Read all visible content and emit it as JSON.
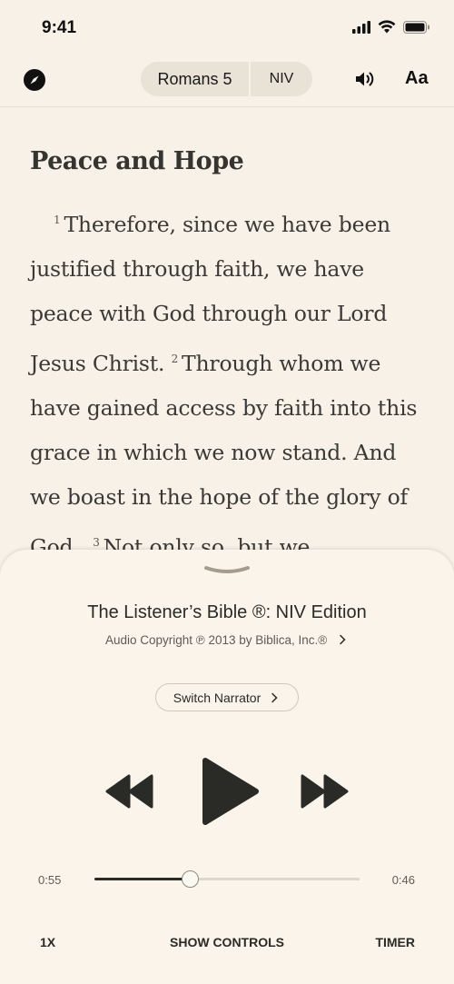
{
  "status_bar": {
    "time": "9:41"
  },
  "toolbar": {
    "book_chapter": "Romans 5",
    "version": "NIV",
    "font_button": "Aa"
  },
  "reader": {
    "section_title": "Peace and Hope",
    "verses": [
      {
        "number": "1",
        "text": "Therefore, since we have been justified through faith, we have peace with God through our Lord Jesus Christ."
      },
      {
        "number": "2",
        "text": "Through whom we have gained access by faith into this grace in which we now stand. And we boast in the hope of the glory of God."
      },
      {
        "number": "3",
        "text": "Not only so, but we"
      }
    ]
  },
  "player": {
    "audio_title": "The Listener’s Bible ®:  NIV Edition",
    "copyright": "Audio Copyright ℗ 2013 by Biblica, Inc.®",
    "switch_narrator": "Switch Narrator",
    "time_elapsed": "0:55",
    "time_remaining": "0:46",
    "progress_fraction": 0.36,
    "speed_label": "1X",
    "show_controls_label": "SHOW CONTROLS",
    "timer_label": "TIMER"
  },
  "icons": {
    "compass": "compass-icon",
    "speaker": "speaker-icon",
    "rewind": "rewind-icon",
    "play": "play-icon",
    "forward": "fast-forward-icon",
    "chevron": "chevron-right-icon",
    "grabber": "grabber-icon"
  },
  "colors": {
    "background": "#f7f1e7",
    "player_background": "#faf4ea",
    "text_primary": "#2a2a26",
    "pill_background": "#e9e2d6"
  }
}
